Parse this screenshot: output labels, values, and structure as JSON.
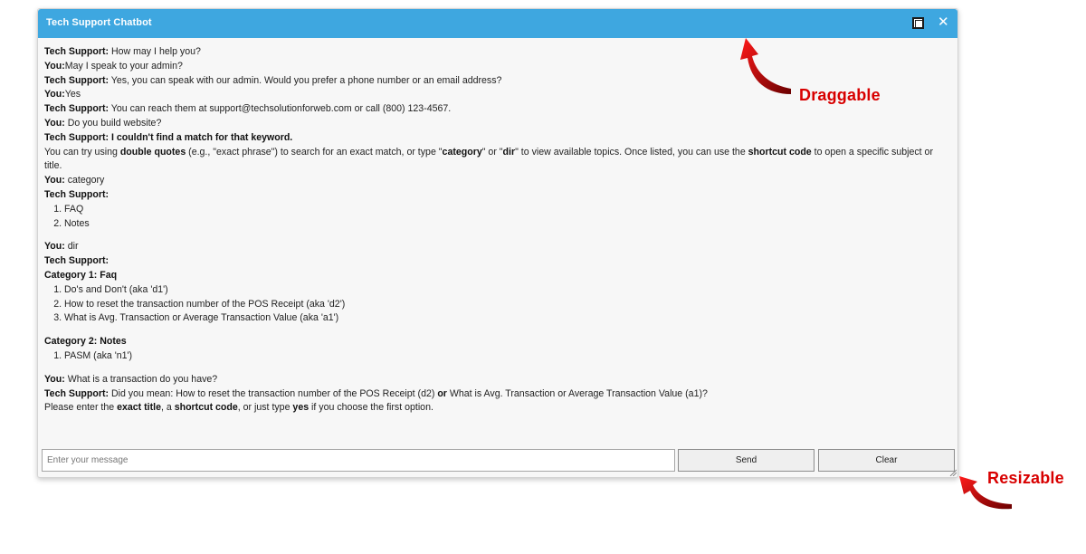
{
  "window": {
    "title": "Tech Support Chatbot",
    "maximize_icon": "maximize-icon",
    "close_glyph": "✕"
  },
  "messages": {
    "m1_speaker": "Tech Support:",
    "m1_text": " How may I help you?",
    "m2_speaker": "You:",
    "m2_text": "May I speak to your admin?",
    "m3_speaker": "Tech Support:",
    "m3_text": " Yes, you can speak with our admin. Would you prefer a phone number or an email address?",
    "m4_speaker": "You:",
    "m4_text": "Yes",
    "m5_speaker": "Tech Support:",
    "m5_text": " You can reach them at support@techsolutionforweb.com or call (800) 123-4567.",
    "m6_speaker": "You:",
    "m6_text": " Do you build website?",
    "m7_heading": "Tech Support: I couldn't find a match for that keyword.",
    "m7_p1": "You can try using ",
    "m7_b1": "double quotes",
    "m7_p2": " (e.g., \"exact phrase\") to search for an exact match, or type \"",
    "m7_b2": "category",
    "m7_p3": "\" or \"",
    "m7_b3": "dir",
    "m7_p4": "\" to view available topics. Once listed, you can use the ",
    "m7_b4": "shortcut code",
    "m7_p5": " to open a specific subject or title.",
    "m8_speaker": "You:",
    "m8_text": " category",
    "m9_speaker": "Tech Support:",
    "m9_items": [
      "FAQ",
      "Notes"
    ],
    "m10_speaker": "You:",
    "m10_text": " dir",
    "m11_speaker": "Tech Support:",
    "m11_cat1": "Category 1: Faq",
    "m11_cat1_items": [
      "Do's and Don't (aka 'd1')",
      "How to reset the transaction number of the POS Receipt (aka 'd2')",
      "What is Avg. Transaction or Average Transaction Value (aka 'a1')"
    ],
    "m11_cat2": "Category 2: Notes",
    "m11_cat2_items": [
      "PASM (aka 'n1')"
    ],
    "m12_speaker": "You:",
    "m12_text": " What is a transaction do you have?",
    "m13_speaker": "Tech Support:",
    "m13_p1": " Did you mean: How to reset the transaction number of the POS Receipt (d2) ",
    "m13_b1": "or",
    "m13_p2": " What is Avg. Transaction or Average Transaction Value (a1)?",
    "m14_p1": "Please enter the ",
    "m14_b1": "exact title",
    "m14_p2": ", a ",
    "m14_b2": "shortcut code",
    "m14_p3": ", or just type ",
    "m14_b3": "yes",
    "m14_p4": " if you choose the first option."
  },
  "composer": {
    "placeholder": "Enter your message",
    "value": "",
    "send_label": "Send",
    "clear_label": "Clear"
  },
  "annotations": {
    "draggable": "Draggable",
    "resizable": "Resizable",
    "color": "#d80000"
  },
  "colors": {
    "titlebar": "#3ea7e0",
    "body": "#f7f7f7"
  }
}
